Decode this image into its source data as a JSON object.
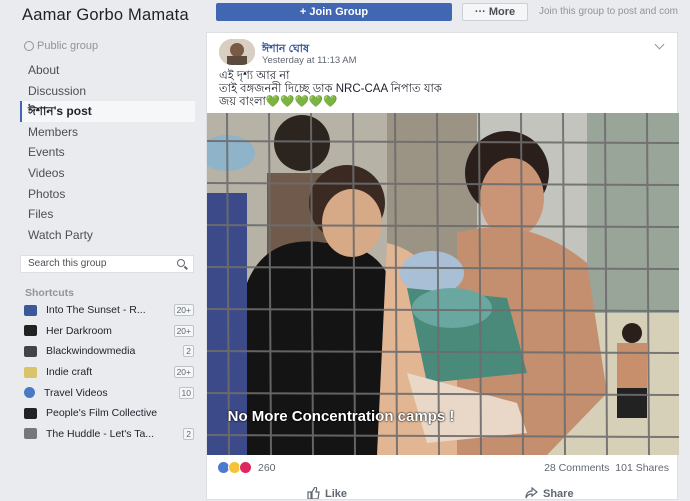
{
  "group": {
    "name": "Aamar Gorbo Mamata",
    "type": "Public group"
  },
  "nav": [
    {
      "label": "About"
    },
    {
      "label": "Discussion"
    },
    {
      "label": "ঈশান's post"
    },
    {
      "label": "Members"
    },
    {
      "label": "Events"
    },
    {
      "label": "Videos"
    },
    {
      "label": "Photos"
    },
    {
      "label": "Files"
    },
    {
      "label": "Watch Party"
    }
  ],
  "search": {
    "placeholder": "Search this group"
  },
  "shortcuts": {
    "title": "Shortcuts",
    "items": [
      {
        "label": "Into The Sunset - R...",
        "count": "20+",
        "color": "#3b5998"
      },
      {
        "label": "Her Darkroom",
        "count": "20+",
        "color": "#222222"
      },
      {
        "label": "Blackwindowmedia",
        "count": "2",
        "color": "#444444"
      },
      {
        "label": "Indie craft",
        "count": "20+",
        "color": "#d9c46b"
      },
      {
        "label": "Travel Videos",
        "count": "10",
        "color": "#4a78c2"
      },
      {
        "label": "People's Film Collective",
        "count": "",
        "color": "#222222"
      },
      {
        "label": "The Huddle - Let's Ta...",
        "count": "2",
        "color": "#777777"
      }
    ]
  },
  "topbar": {
    "join": "+ Join Group",
    "more": "··· More",
    "join_text": "Join this group to post and com"
  },
  "post": {
    "author": "ঈশান ঘোষ",
    "time": "Yesterday at 11:13 AM",
    "lines": [
      "এই দৃশ্য আর না",
      "তাই বঙ্গজননী দিচ্ছে ডাক NRC-CAA নিপাত যাক",
      "জয় বাংলা"
    ],
    "hearts": "💚💚💚💚💚",
    "caption": "No More Concentration camps !",
    "reactions": "260",
    "comments": "28 Comments",
    "shares": "101 Shares",
    "like": "Like",
    "share": "Share"
  },
  "colors": {
    "accent": "#4267b2",
    "link": "#365899"
  }
}
